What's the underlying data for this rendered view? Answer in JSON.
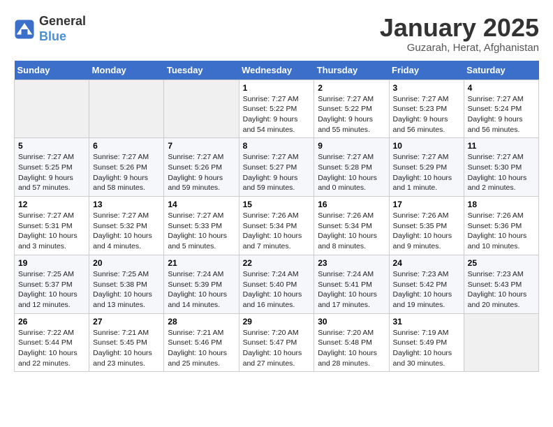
{
  "header": {
    "logo_line1": "General",
    "logo_line2": "Blue",
    "title": "January 2025",
    "subtitle": "Guzarah, Herat, Afghanistan"
  },
  "weekdays": [
    "Sunday",
    "Monday",
    "Tuesday",
    "Wednesday",
    "Thursday",
    "Friday",
    "Saturday"
  ],
  "weeks": [
    [
      {
        "day": "",
        "sunrise": "",
        "sunset": "",
        "daylight": ""
      },
      {
        "day": "",
        "sunrise": "",
        "sunset": "",
        "daylight": ""
      },
      {
        "day": "",
        "sunrise": "",
        "sunset": "",
        "daylight": ""
      },
      {
        "day": "1",
        "sunrise": "Sunrise: 7:27 AM",
        "sunset": "Sunset: 5:22 PM",
        "daylight": "Daylight: 9 hours and 54 minutes."
      },
      {
        "day": "2",
        "sunrise": "Sunrise: 7:27 AM",
        "sunset": "Sunset: 5:22 PM",
        "daylight": "Daylight: 9 hours and 55 minutes."
      },
      {
        "day": "3",
        "sunrise": "Sunrise: 7:27 AM",
        "sunset": "Sunset: 5:23 PM",
        "daylight": "Daylight: 9 hours and 56 minutes."
      },
      {
        "day": "4",
        "sunrise": "Sunrise: 7:27 AM",
        "sunset": "Sunset: 5:24 PM",
        "daylight": "Daylight: 9 hours and 56 minutes."
      }
    ],
    [
      {
        "day": "5",
        "sunrise": "Sunrise: 7:27 AM",
        "sunset": "Sunset: 5:25 PM",
        "daylight": "Daylight: 9 hours and 57 minutes."
      },
      {
        "day": "6",
        "sunrise": "Sunrise: 7:27 AM",
        "sunset": "Sunset: 5:26 PM",
        "daylight": "Daylight: 9 hours and 58 minutes."
      },
      {
        "day": "7",
        "sunrise": "Sunrise: 7:27 AM",
        "sunset": "Sunset: 5:26 PM",
        "daylight": "Daylight: 9 hours and 59 minutes."
      },
      {
        "day": "8",
        "sunrise": "Sunrise: 7:27 AM",
        "sunset": "Sunset: 5:27 PM",
        "daylight": "Daylight: 9 hours and 59 minutes."
      },
      {
        "day": "9",
        "sunrise": "Sunrise: 7:27 AM",
        "sunset": "Sunset: 5:28 PM",
        "daylight": "Daylight: 10 hours and 0 minutes."
      },
      {
        "day": "10",
        "sunrise": "Sunrise: 7:27 AM",
        "sunset": "Sunset: 5:29 PM",
        "daylight": "Daylight: 10 hours and 1 minute."
      },
      {
        "day": "11",
        "sunrise": "Sunrise: 7:27 AM",
        "sunset": "Sunset: 5:30 PM",
        "daylight": "Daylight: 10 hours and 2 minutes."
      }
    ],
    [
      {
        "day": "12",
        "sunrise": "Sunrise: 7:27 AM",
        "sunset": "Sunset: 5:31 PM",
        "daylight": "Daylight: 10 hours and 3 minutes."
      },
      {
        "day": "13",
        "sunrise": "Sunrise: 7:27 AM",
        "sunset": "Sunset: 5:32 PM",
        "daylight": "Daylight: 10 hours and 4 minutes."
      },
      {
        "day": "14",
        "sunrise": "Sunrise: 7:27 AM",
        "sunset": "Sunset: 5:33 PM",
        "daylight": "Daylight: 10 hours and 5 minutes."
      },
      {
        "day": "15",
        "sunrise": "Sunrise: 7:26 AM",
        "sunset": "Sunset: 5:34 PM",
        "daylight": "Daylight: 10 hours and 7 minutes."
      },
      {
        "day": "16",
        "sunrise": "Sunrise: 7:26 AM",
        "sunset": "Sunset: 5:34 PM",
        "daylight": "Daylight: 10 hours and 8 minutes."
      },
      {
        "day": "17",
        "sunrise": "Sunrise: 7:26 AM",
        "sunset": "Sunset: 5:35 PM",
        "daylight": "Daylight: 10 hours and 9 minutes."
      },
      {
        "day": "18",
        "sunrise": "Sunrise: 7:26 AM",
        "sunset": "Sunset: 5:36 PM",
        "daylight": "Daylight: 10 hours and 10 minutes."
      }
    ],
    [
      {
        "day": "19",
        "sunrise": "Sunrise: 7:25 AM",
        "sunset": "Sunset: 5:37 PM",
        "daylight": "Daylight: 10 hours and 12 minutes."
      },
      {
        "day": "20",
        "sunrise": "Sunrise: 7:25 AM",
        "sunset": "Sunset: 5:38 PM",
        "daylight": "Daylight: 10 hours and 13 minutes."
      },
      {
        "day": "21",
        "sunrise": "Sunrise: 7:24 AM",
        "sunset": "Sunset: 5:39 PM",
        "daylight": "Daylight: 10 hours and 14 minutes."
      },
      {
        "day": "22",
        "sunrise": "Sunrise: 7:24 AM",
        "sunset": "Sunset: 5:40 PM",
        "daylight": "Daylight: 10 hours and 16 minutes."
      },
      {
        "day": "23",
        "sunrise": "Sunrise: 7:24 AM",
        "sunset": "Sunset: 5:41 PM",
        "daylight": "Daylight: 10 hours and 17 minutes."
      },
      {
        "day": "24",
        "sunrise": "Sunrise: 7:23 AM",
        "sunset": "Sunset: 5:42 PM",
        "daylight": "Daylight: 10 hours and 19 minutes."
      },
      {
        "day": "25",
        "sunrise": "Sunrise: 7:23 AM",
        "sunset": "Sunset: 5:43 PM",
        "daylight": "Daylight: 10 hours and 20 minutes."
      }
    ],
    [
      {
        "day": "26",
        "sunrise": "Sunrise: 7:22 AM",
        "sunset": "Sunset: 5:44 PM",
        "daylight": "Daylight: 10 hours and 22 minutes."
      },
      {
        "day": "27",
        "sunrise": "Sunrise: 7:21 AM",
        "sunset": "Sunset: 5:45 PM",
        "daylight": "Daylight: 10 hours and 23 minutes."
      },
      {
        "day": "28",
        "sunrise": "Sunrise: 7:21 AM",
        "sunset": "Sunset: 5:46 PM",
        "daylight": "Daylight: 10 hours and 25 minutes."
      },
      {
        "day": "29",
        "sunrise": "Sunrise: 7:20 AM",
        "sunset": "Sunset: 5:47 PM",
        "daylight": "Daylight: 10 hours and 27 minutes."
      },
      {
        "day": "30",
        "sunrise": "Sunrise: 7:20 AM",
        "sunset": "Sunset: 5:48 PM",
        "daylight": "Daylight: 10 hours and 28 minutes."
      },
      {
        "day": "31",
        "sunrise": "Sunrise: 7:19 AM",
        "sunset": "Sunset: 5:49 PM",
        "daylight": "Daylight: 10 hours and 30 minutes."
      },
      {
        "day": "",
        "sunrise": "",
        "sunset": "",
        "daylight": ""
      }
    ]
  ]
}
